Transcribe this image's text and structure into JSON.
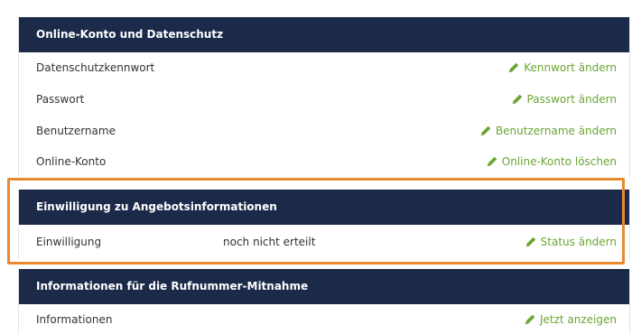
{
  "sections": {
    "account": {
      "title": "Online-Konto und Datenschutz",
      "rows": [
        {
          "label": "Datenschutzkennwort",
          "action": "Kennwort ändern"
        },
        {
          "label": "Passwort",
          "action": "Passwort ändern"
        },
        {
          "label": "Benutzername",
          "action": "Benutzername ändern"
        },
        {
          "label": "Online-Konto",
          "action": "Online-Konto löschen"
        }
      ]
    },
    "consent": {
      "title": "Einwilligung zu Angebotsinformationen",
      "rows": [
        {
          "label": "Einwilligung",
          "value": "noch nicht erteilt",
          "action": "Status ändern"
        }
      ]
    },
    "porting": {
      "title": "Informationen für die Rufnummer-Mitnahme",
      "rows": [
        {
          "label": "Informationen",
          "action": "Jetzt anzeigen"
        }
      ]
    }
  },
  "icons": {
    "action_icon": "pencil-icon"
  },
  "colors": {
    "header_bg": "#1c2a4a",
    "action_green": "#6aa633",
    "highlight_orange": "#e8892f"
  }
}
